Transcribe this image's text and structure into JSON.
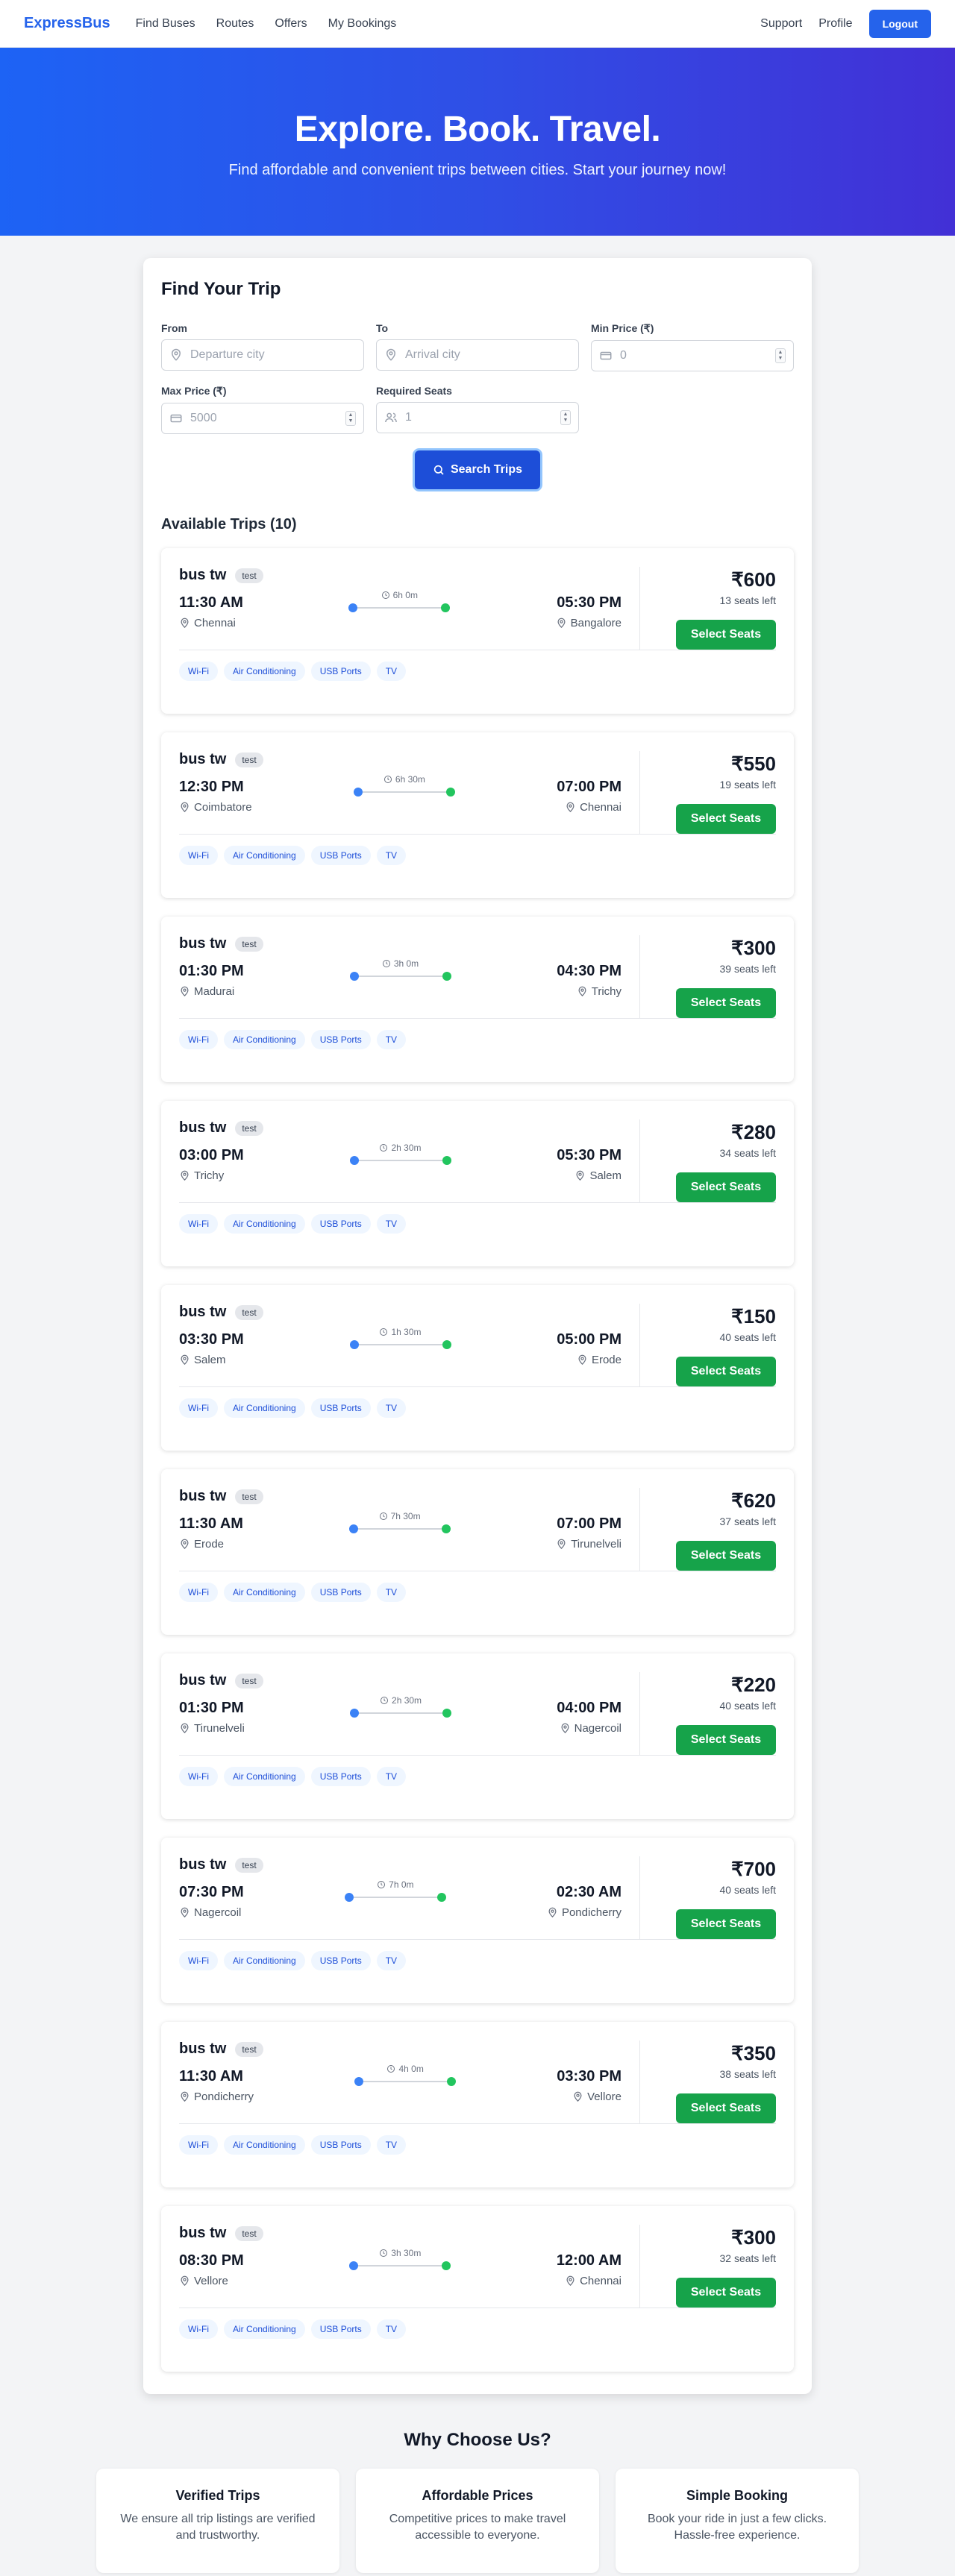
{
  "nav": {
    "brand": "ExpressBus",
    "links": [
      "Find Buses",
      "Routes",
      "Offers",
      "My Bookings"
    ],
    "right_links": [
      "Support",
      "Profile"
    ],
    "logout": "Logout"
  },
  "hero": {
    "title": "Explore. Book. Travel.",
    "subtitle": "Find affordable and convenient trips between cities. Start your journey now!"
  },
  "search": {
    "title": "Find Your Trip",
    "from_label": "From",
    "from_placeholder": "Departure city",
    "to_label": "To",
    "to_placeholder": "Arrival city",
    "min_price_label": "Min Price (₹)",
    "min_price_placeholder": "0",
    "max_price_label": "Max Price (₹)",
    "max_price_placeholder": "5000",
    "seats_label": "Required Seats",
    "seats_placeholder": "1",
    "button": "Search Trips"
  },
  "results": {
    "title": "Available Trips (10)",
    "select_label": "Select Seats",
    "trips": [
      {
        "bus": "bus tw",
        "tag": "test",
        "dep_time": "11:30 AM",
        "from": "Chennai",
        "duration": "6h 0m",
        "arr_time": "05:30 PM",
        "to": "Bangalore",
        "price": "₹600",
        "seats": "13 seats left",
        "amenities": [
          "Wi-Fi",
          "Air Conditioning",
          "USB Ports",
          "TV"
        ]
      },
      {
        "bus": "bus tw",
        "tag": "test",
        "dep_time": "12:30 PM",
        "from": "Coimbatore",
        "duration": "6h 30m",
        "arr_time": "07:00 PM",
        "to": "Chennai",
        "price": "₹550",
        "seats": "19 seats left",
        "amenities": [
          "Wi-Fi",
          "Air Conditioning",
          "USB Ports",
          "TV"
        ]
      },
      {
        "bus": "bus tw",
        "tag": "test",
        "dep_time": "01:30 PM",
        "from": "Madurai",
        "duration": "3h 0m",
        "arr_time": "04:30 PM",
        "to": "Trichy",
        "price": "₹300",
        "seats": "39 seats left",
        "amenities": [
          "Wi-Fi",
          "Air Conditioning",
          "USB Ports",
          "TV"
        ]
      },
      {
        "bus": "bus tw",
        "tag": "test",
        "dep_time": "03:00 PM",
        "from": "Trichy",
        "duration": "2h 30m",
        "arr_time": "05:30 PM",
        "to": "Salem",
        "price": "₹280",
        "seats": "34 seats left",
        "amenities": [
          "Wi-Fi",
          "Air Conditioning",
          "USB Ports",
          "TV"
        ]
      },
      {
        "bus": "bus tw",
        "tag": "test",
        "dep_time": "03:30 PM",
        "from": "Salem",
        "duration": "1h 30m",
        "arr_time": "05:00 PM",
        "to": "Erode",
        "price": "₹150",
        "seats": "40 seats left",
        "amenities": [
          "Wi-Fi",
          "Air Conditioning",
          "USB Ports",
          "TV"
        ]
      },
      {
        "bus": "bus tw",
        "tag": "test",
        "dep_time": "11:30 AM",
        "from": "Erode",
        "duration": "7h 30m",
        "arr_time": "07:00 PM",
        "to": "Tirunelveli",
        "price": "₹620",
        "seats": "37 seats left",
        "amenities": [
          "Wi-Fi",
          "Air Conditioning",
          "USB Ports",
          "TV"
        ]
      },
      {
        "bus": "bus tw",
        "tag": "test",
        "dep_time": "01:30 PM",
        "from": "Tirunelveli",
        "duration": "2h 30m",
        "arr_time": "04:00 PM",
        "to": "Nagercoil",
        "price": "₹220",
        "seats": "40 seats left",
        "amenities": [
          "Wi-Fi",
          "Air Conditioning",
          "USB Ports",
          "TV"
        ]
      },
      {
        "bus": "bus tw",
        "tag": "test",
        "dep_time": "07:30 PM",
        "from": "Nagercoil",
        "duration": "7h 0m",
        "arr_time": "02:30 AM",
        "to": "Pondicherry",
        "price": "₹700",
        "seats": "40 seats left",
        "amenities": [
          "Wi-Fi",
          "Air Conditioning",
          "USB Ports",
          "TV"
        ]
      },
      {
        "bus": "bus tw",
        "tag": "test",
        "dep_time": "11:30 AM",
        "from": "Pondicherry",
        "duration": "4h 0m",
        "arr_time": "03:30 PM",
        "to": "Vellore",
        "price": "₹350",
        "seats": "38 seats left",
        "amenities": [
          "Wi-Fi",
          "Air Conditioning",
          "USB Ports",
          "TV"
        ]
      },
      {
        "bus": "bus tw",
        "tag": "test",
        "dep_time": "08:30 PM",
        "from": "Vellore",
        "duration": "3h 30m",
        "arr_time": "12:00 AM",
        "to": "Chennai",
        "price": "₹300",
        "seats": "32 seats left",
        "amenities": [
          "Wi-Fi",
          "Air Conditioning",
          "USB Ports",
          "TV"
        ]
      }
    ]
  },
  "why": {
    "title": "Why Choose Us?",
    "cards": [
      {
        "title": "Verified Trips",
        "text": "We ensure all trip listings are verified and trustworthy."
      },
      {
        "title": "Affordable Prices",
        "text": "Competitive prices to make travel accessible to everyone."
      },
      {
        "title": "Simple Booking",
        "text": "Book your ride in just a few clicks. Hassle-free experience."
      }
    ]
  },
  "colors": {
    "brand": "#2563eb",
    "hero_start": "#1d63f5",
    "hero_end": "#4230d6",
    "success": "#16a34a",
    "route_start_dot": "#3b82f6",
    "route_end_dot": "#22c55e"
  }
}
